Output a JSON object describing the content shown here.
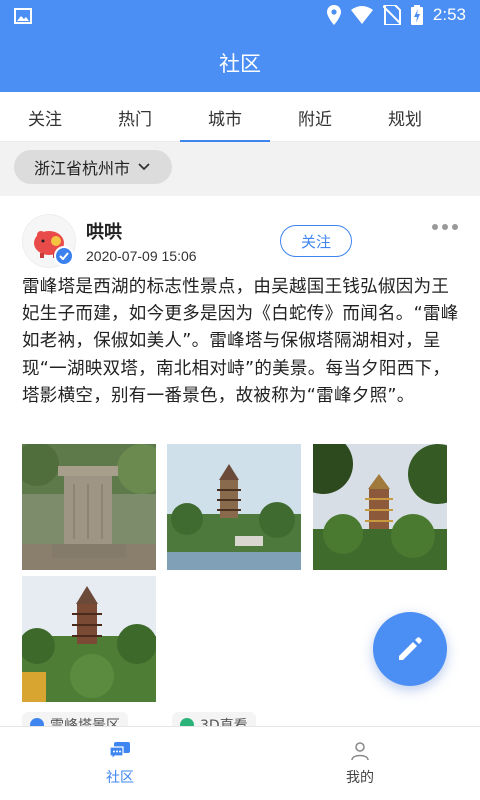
{
  "status_bar": {
    "time": "2:53"
  },
  "header": {
    "title": "社区"
  },
  "tabs": [
    {
      "label": "关注",
      "active": false
    },
    {
      "label": "热门",
      "active": false
    },
    {
      "label": "城市",
      "active": true
    },
    {
      "label": "附近",
      "active": false
    },
    {
      "label": "规划",
      "active": false
    }
  ],
  "filter": {
    "city": "浙江省杭州市"
  },
  "post": {
    "username": "哄哄",
    "timestamp": "2020-07-09 15:06",
    "follow_label": "关注",
    "text": "雷峰塔是西湖的标志性景点，由吴越国王钱弘俶因为王妃生子而建，如今更多是因为《白蛇传》而闻名。“雷峰如老衲，保俶如美人”。雷峰塔与保俶塔隔湖相对，呈现“一湖映双塔，南北相对峙”的美景。每当夕阳西下，塔影横空，别有一番景色，故被称为“雷峰夕照”。",
    "tags": [
      "雷峰塔景区",
      "3D直看"
    ]
  },
  "bottom_nav": [
    {
      "label": "社区",
      "active": true
    },
    {
      "label": "我的",
      "active": false
    }
  ],
  "colors": {
    "primary": "#4b8ff4",
    "accent": "#3f85f0"
  }
}
